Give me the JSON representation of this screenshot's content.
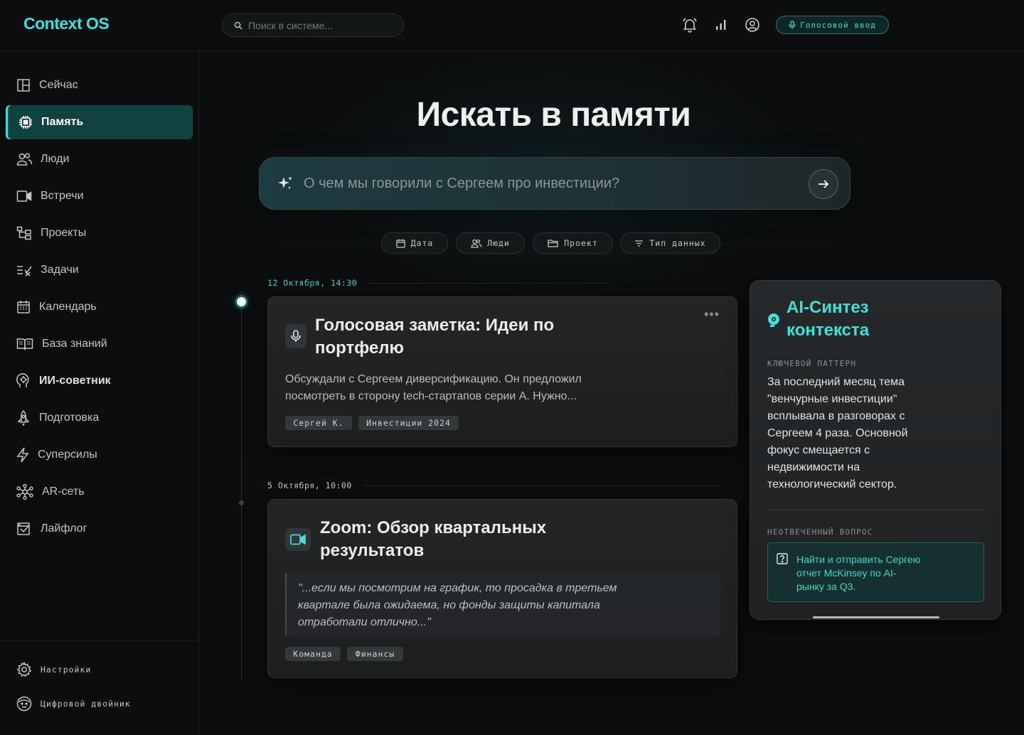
{
  "header": {
    "logo": "Context OS",
    "search_placeholder": "Поиск в системе...",
    "voice_button": "Голосовой ввод",
    "icons": [
      "bell-icon",
      "signal-bars-icon",
      "user-circle-icon"
    ]
  },
  "sidebar": {
    "items": [
      {
        "label": "Сейчас",
        "icon": "layout-icon"
      },
      {
        "label": "Память",
        "icon": "chip-icon",
        "active": true
      },
      {
        "label": "Люди",
        "icon": "people-icon"
      },
      {
        "label": "Встречи",
        "icon": "video-icon"
      },
      {
        "label": "Проекты",
        "icon": "hierarchy-icon"
      },
      {
        "label": "Задачи",
        "icon": "checklist-icon"
      },
      {
        "label": "Календарь",
        "icon": "calendar-icon"
      },
      {
        "label": "База знаний",
        "icon": "book-icon"
      },
      {
        "label": "ИИ-советник",
        "icon": "brain-icon"
      },
      {
        "label": "Подготовка",
        "icon": "rocket-icon"
      },
      {
        "label": "Суперсилы",
        "icon": "lightning-icon"
      },
      {
        "label": "AR-сеть",
        "icon": "network-icon"
      },
      {
        "label": "Лайфлог",
        "icon": "journal-icon"
      }
    ],
    "bottom": {
      "settings": "Настройки",
      "twin": "Цифровой двойник"
    }
  },
  "main": {
    "title": "Искать в памяти",
    "search_placeholder": "О чем мы говорили с Сергеем про инвестиции?",
    "filters": [
      "Дата",
      "Люди",
      "Проект",
      "Тип данных"
    ]
  },
  "timeline": [
    {
      "date": "12 Октября, 14:30",
      "title_line1": "Голосовая заметка: Идеи по",
      "title_line2": "портфелю",
      "text_line1": "Обсуждали с Сергеем диверсификацию. Он предложил",
      "text_line2": "посмотреть в сторону tech-стартапов серии А. Нужно...",
      "tags": [
        "Сергей К.",
        "Инвестиции 2024"
      ],
      "more": "•••"
    },
    {
      "date": "5 Октября, 10:00",
      "title_line1": "Zoom: Обзор квартальных",
      "title_line2": "результатов",
      "quote_line1": "\"...если мы посмотрим на график, то просадка в третьем",
      "quote_line2": "квартале была ожидаема, но фонды защиты капитала",
      "quote_line3": "отработали отлично...\"",
      "tags": [
        "Команда",
        "Финансы"
      ]
    }
  ],
  "ai_panel": {
    "title_line1": "AI-Синтез",
    "title_line2": "контекста",
    "key_pattern_label": "КЛЮЧЕВОЙ ПАТТЕРН",
    "key_pattern_lines": [
      "За последний месяц тема",
      "\"венчурные инвестиции\"",
      "всплывала в разговорах с",
      "Сергеем 4 раза. Основной",
      "фокус смещается с",
      "недвижимости на",
      "технологический сектор."
    ],
    "question_label": "НЕОТВЕЧЕННЫЙ ВОПРОС",
    "action_lines": [
      "Найти и отправить Сергею",
      "отчет McKinsey по AI-",
      "рынку за Q3."
    ]
  },
  "colors": {
    "accent": "#3fe0d6",
    "active_bg": "#124240",
    "background": "#0b0d0e"
  }
}
